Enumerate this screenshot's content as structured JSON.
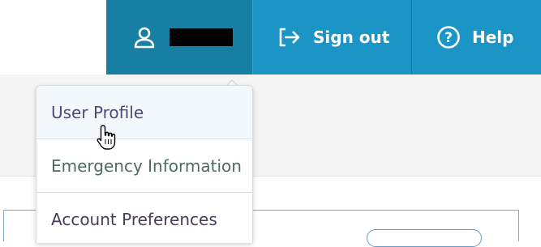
{
  "header": {
    "user_name_redacted": "",
    "sign_out_label": "Sign out",
    "help_label": "Help"
  },
  "icons": {
    "user": "user-icon",
    "sign_out": "sign-out-icon",
    "help": "help-circle-icon",
    "cursor": "hand-pointer-cursor"
  },
  "user_menu": {
    "items": [
      {
        "label": "User Profile"
      },
      {
        "label": "Emergency Information"
      },
      {
        "label": "Account Preferences"
      }
    ]
  },
  "colors": {
    "user_button_bg": "#177fa3",
    "nav_button_bg": "#1a95c6",
    "menu_hover_bg": "#f3f8fc"
  }
}
